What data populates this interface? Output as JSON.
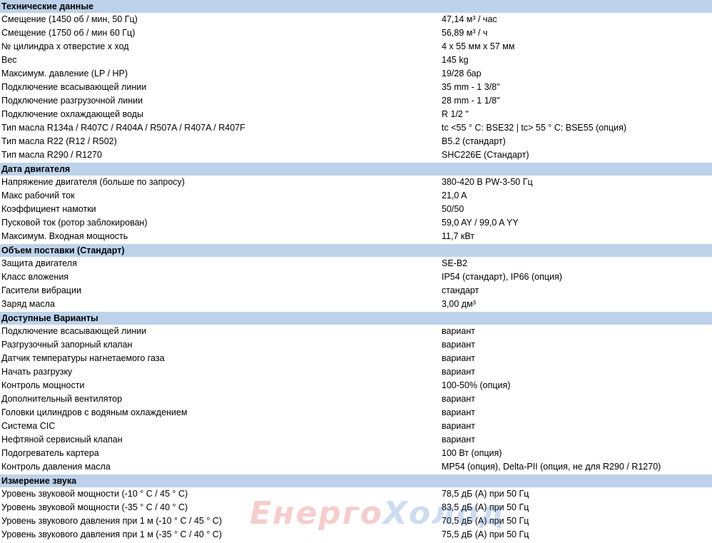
{
  "sections": [
    {
      "title": "Технические данные",
      "rows": [
        [
          "Смещение (1450 об / мин, 50 Гц)",
          "47,14 м³ / час"
        ],
        [
          "Смещение (1750 об / мин 60 Гц)",
          "56,89 м³ / ч"
        ],
        [
          "№ цилиндра x отверстие x ход",
          "4 x 55 мм x 57 мм"
        ],
        [
          "Вес",
          "145 kg"
        ],
        [
          "Максимум. давление (LP / HP)",
          "19/28 бар"
        ],
        [
          "Подключение всасывающей линии",
          "35 mm - 1 3/8\""
        ],
        [
          "Подключение разгрузочной линии",
          "28 mm - 1 1/8\""
        ],
        [
          "Подключение охлаждающей воды",
          "R 1/2 \""
        ],
        [
          "Тип масла R134a / R407C / R404A / R507A / R407A / R407F",
          "tc <55 ° C: BSE32 | tc> 55 ° C: BSE55 (опция)"
        ],
        [
          "Тип масла R22 (R12 / R502)",
          "B5.2 (стандарт)"
        ],
        [
          "Тип масла R290 / R1270",
          "SHC226E (Стандарт)"
        ]
      ]
    },
    {
      "title": "Дата двигателя",
      "rows": [
        [
          "Напряжение двигателя (больше по запросу)",
          "380-420 В PW-3-50 Гц"
        ],
        [
          "Макс рабочий ток",
          "21,0 A"
        ],
        [
          "Коэффициент намотки",
          "50/50"
        ],
        [
          "Пусковой ток (ротор заблокирован)",
          "59,0 AY / 99,0 A YY"
        ],
        [
          "Максимум. Входная мощность",
          "11,7 кВт"
        ]
      ]
    },
    {
      "title": "Объем поставки (Стандарт)",
      "rows": [
        [
          "Защита двигателя",
          "SE-B2"
        ],
        [
          "Класс вложения",
          "IP54 (стандарт), IP66 (опция)"
        ],
        [
          "Гасители вибрации",
          "стандарт"
        ],
        [
          "Заряд масла",
          "3,00 дм³"
        ]
      ]
    },
    {
      "title": "Доступные Варианты",
      "rows": [
        [
          "Подключение всасывающей линии",
          "вариант"
        ],
        [
          "Разгрузочный запорный клапан",
          "вариант"
        ],
        [
          "Датчик температуры нагнетаемого газа",
          "вариант"
        ],
        [
          "Начать разгрузку",
          "вариант"
        ],
        [
          "Контроль мощности",
          "100-50% (опция)"
        ],
        [
          "Дополнительный вентилятор",
          "вариант"
        ],
        [
          "Головки цилиндров с водяным охлаждением",
          "вариант"
        ],
        [
          "Система CIC",
          "вариант"
        ],
        [
          "Нефтяной сервисный клапан",
          "вариант"
        ],
        [
          "Подогреватель картера",
          "100 Вт (опция)"
        ],
        [
          "Контроль давления масла",
          "MP54 (опция), Delta-PII (опция, не для R290 / R1270)"
        ]
      ]
    },
    {
      "title": "Измерение звука",
      "rows": [
        [
          "Уровень звуковой мощности (-10 ° C / 45 ° C)",
          "78,5 дБ (A) при 50 Гц"
        ],
        [
          "Уровень звуковой мощности (-35 ° C / 40 ° C)",
          "83,5 дБ (A) при 50 Гц"
        ],
        [
          "Уровень звукового давления при 1 м (-10 ° C / 45 ° C)",
          "70,5 дБ (A) при 50 Гц"
        ],
        [
          "Уровень звукового давления при 1 м (-35 ° C / 40 ° C)",
          "75,5 дБ (A) при 50 Гц"
        ]
      ]
    }
  ],
  "watermark": {
    "part1": "Енерго",
    "part2": "Холод"
  },
  "colors": {
    "header_bg": "#bdd2ea",
    "text": "#000000"
  }
}
